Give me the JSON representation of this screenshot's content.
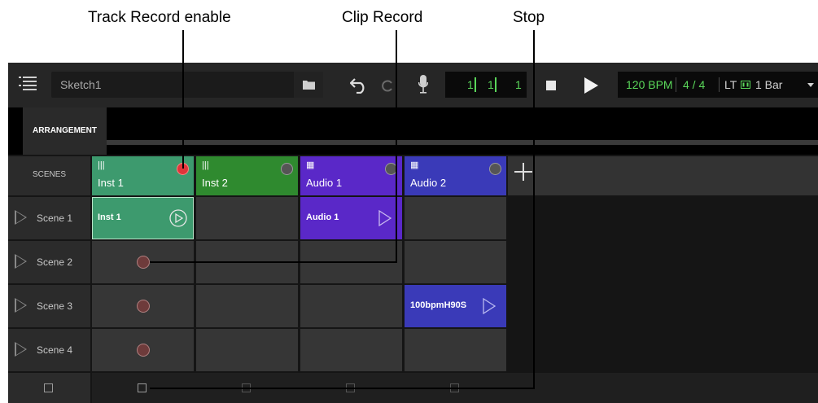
{
  "callouts": {
    "track_record": "Track Record enable",
    "clip_record": "Clip Record",
    "stop": "Stop"
  },
  "toolbar": {
    "project_name": "Sketch1",
    "position": {
      "bars": "1",
      "beats": "1",
      "sixteenths": "1"
    },
    "tempo": "120 BPM",
    "time_signature": "4 / 4",
    "lt_label": "LT",
    "loop_length": "1 Bar",
    "icons": [
      "list-menu-icon",
      "folder-icon",
      "undo-icon",
      "redo-icon",
      "microphone-icon",
      "stop-icon",
      "play-icon",
      "metronome-icon",
      "chevron-down-icon"
    ]
  },
  "arrangement": {
    "tab_label": "ARRANGEMENT"
  },
  "scenes": {
    "header": "SCENES",
    "items": [
      "Scene 1",
      "Scene 2",
      "Scene 3",
      "Scene 4"
    ]
  },
  "tracks": [
    {
      "name": "Inst 1",
      "type": "instrument",
      "color": "#3d9a6e",
      "record_armed": true
    },
    {
      "name": "Inst 2",
      "type": "instrument",
      "color": "#2f8a2f",
      "record_armed": false
    },
    {
      "name": "Audio 1",
      "type": "audio",
      "color": "#5a28c8",
      "record_armed": false
    },
    {
      "name": "Audio 2",
      "type": "audio",
      "color": "#3a3ab8",
      "record_armed": false
    }
  ],
  "clips": {
    "inst1_scene1": "Inst 1",
    "audio1_scene1": "Audio 1",
    "audio2_scene3": "100bpmH90S"
  },
  "colors": {
    "accent_green": "#5ad75a",
    "record_red": "#e0343a"
  }
}
